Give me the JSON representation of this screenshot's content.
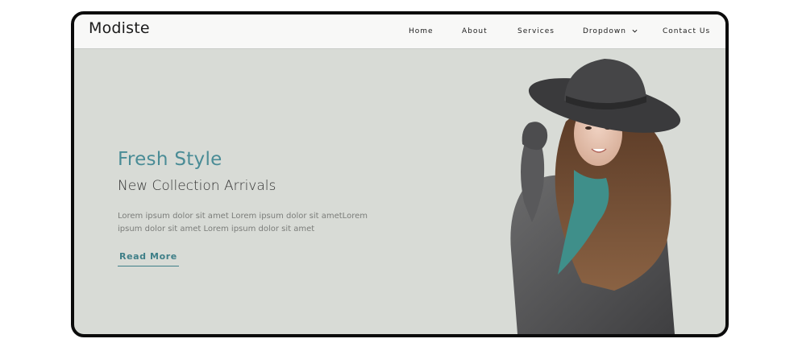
{
  "brand": "Modiste",
  "nav": {
    "home": "Home",
    "about": "About",
    "services": "Services",
    "dropdown": "Dropdown",
    "contact": "Contact Us"
  },
  "hero": {
    "headline": "Fresh Style",
    "subheadline": "New Collection Arrivals",
    "description": "Lorem ipsum dolor sit amet Lorem ipsum dolor sit ametLorem ipsum dolor sit amet Lorem ipsum dolor sit amet",
    "cta_label": "Read More"
  },
  "colors": {
    "hero_background": "#d8dbd6",
    "accent": "#4a8c96",
    "frame": "#0b0b0b"
  },
  "icons": {
    "dropdown": "chevron-down-icon"
  }
}
